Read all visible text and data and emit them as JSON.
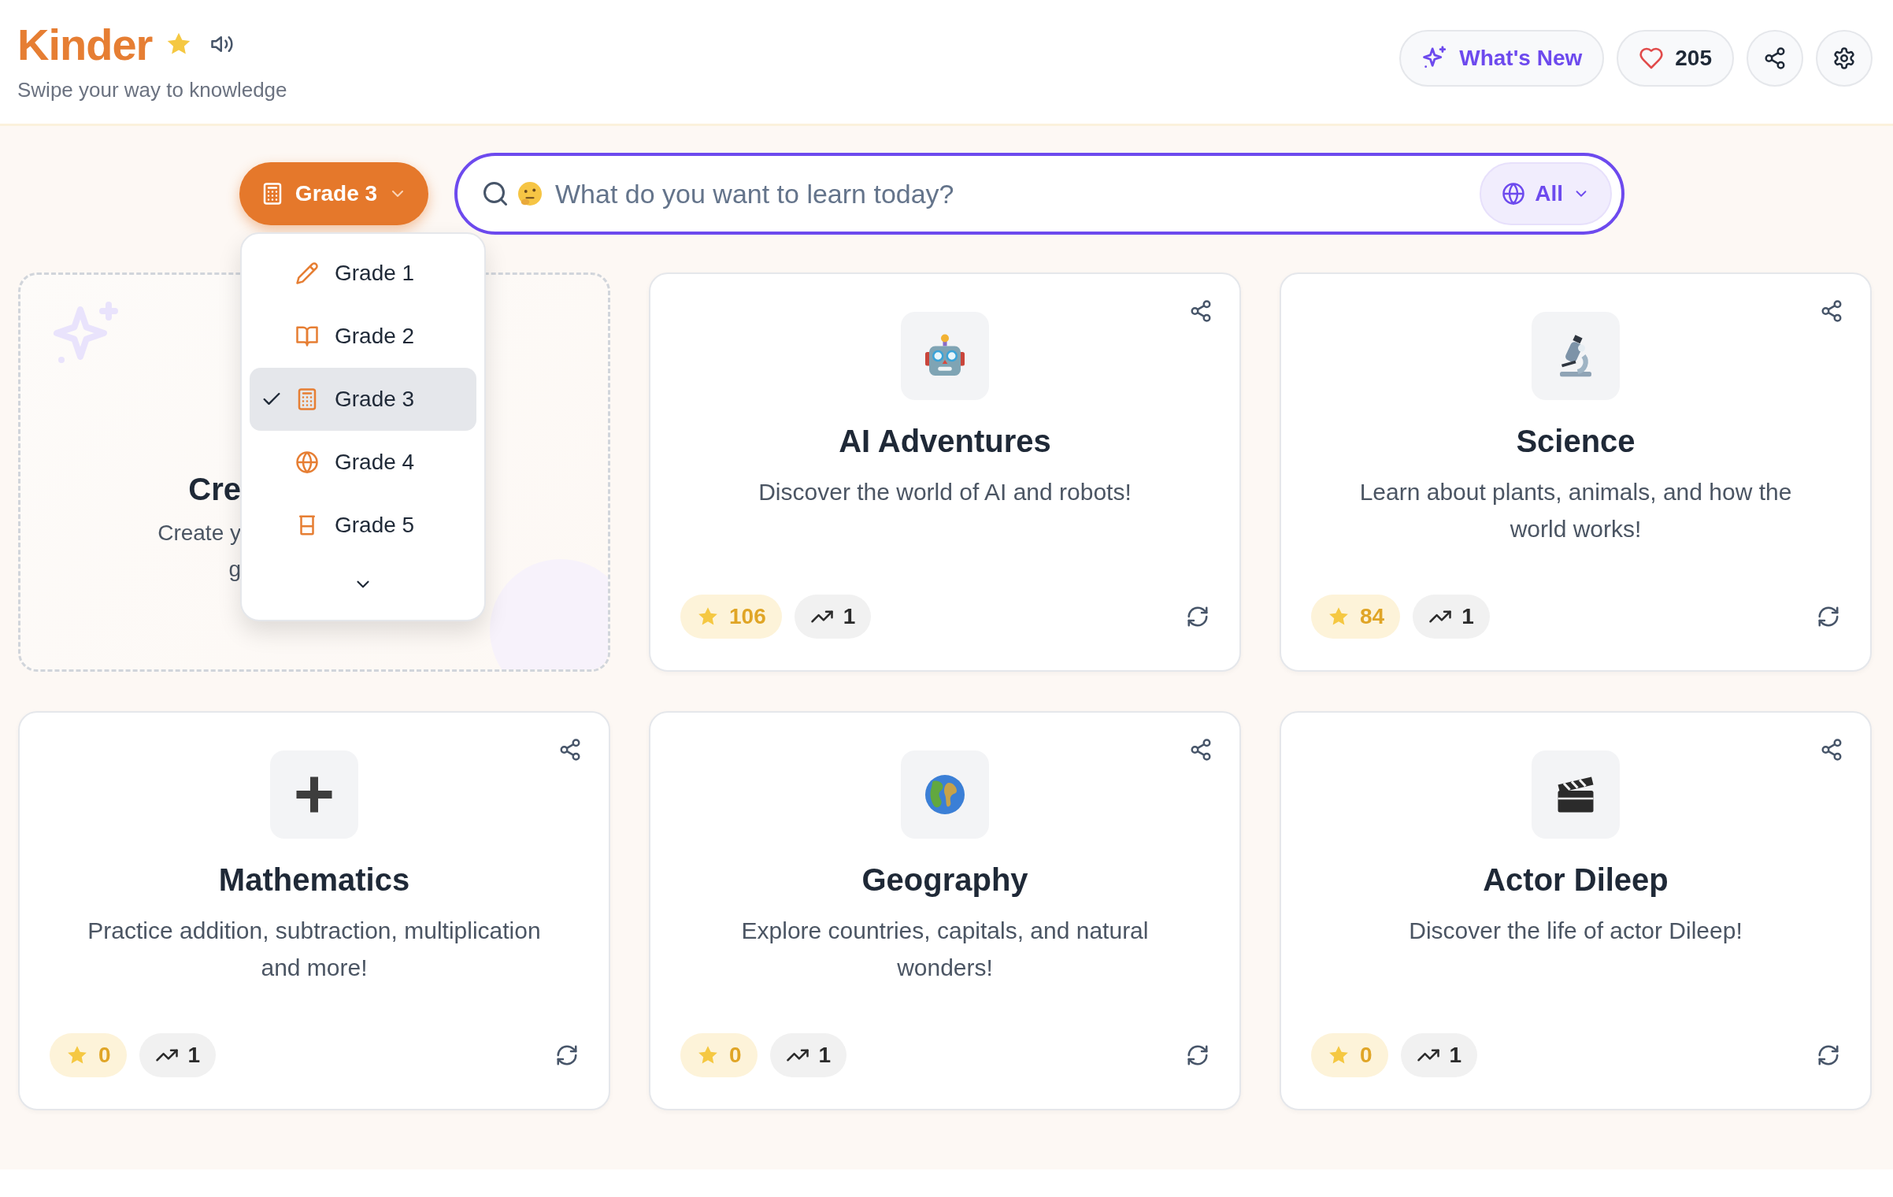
{
  "header": {
    "title": "Kinder",
    "subtitle": "Swipe your way to knowledge",
    "whats_new": "What's New",
    "likes": "205"
  },
  "grade_select": {
    "label": "Grade 3",
    "expanded": true
  },
  "search": {
    "placeholder": "What do you want to learn today?",
    "filter": "All"
  },
  "grade_menu": [
    {
      "label": "Grade 1",
      "selected": false
    },
    {
      "label": "Grade 2",
      "selected": false
    },
    {
      "label": "Grade 3",
      "selected": true
    },
    {
      "label": "Grade 4",
      "selected": false
    },
    {
      "label": "Grade 5",
      "selected": false
    }
  ],
  "create_card": {
    "title": "Cre",
    "lines": [
      "Create y",
      "g"
    ]
  },
  "topics": [
    {
      "title": "AI Adventures",
      "description": "Discover the world of AI and robots!",
      "rating": "106",
      "trend": "1"
    },
    {
      "title": "Science",
      "description": "Learn about plants, animals, and how the world works!",
      "rating": "84",
      "trend": "1"
    },
    {
      "title": "Mathematics",
      "description": "Practice addition, subtraction, multiplication and more!",
      "rating": "0",
      "trend": "1"
    },
    {
      "title": "Geography",
      "description": "Explore countries, capitals, and natural wonders!",
      "rating": "0",
      "trend": "1"
    },
    {
      "title": "Actor Dileep",
      "description": "Discover the life of actor Dileep!",
      "rating": "0",
      "trend": "1"
    }
  ]
}
